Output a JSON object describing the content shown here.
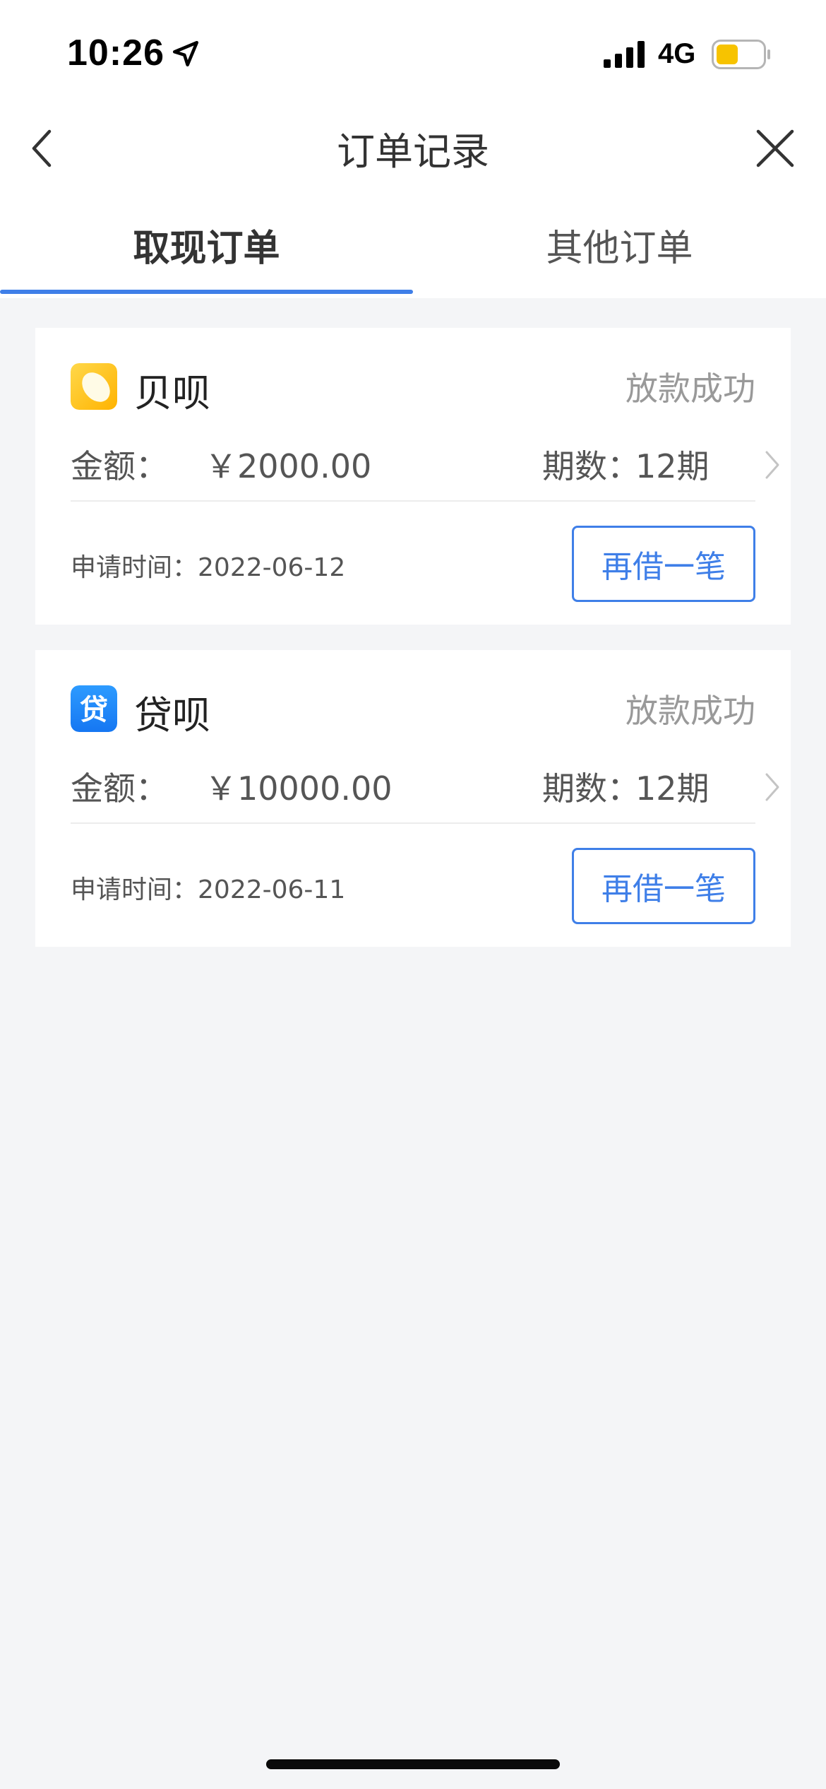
{
  "status_bar": {
    "time": "10:26",
    "network": "4G",
    "colors": {
      "battery_fill": "#f7c300"
    }
  },
  "nav": {
    "title": "订单记录"
  },
  "tabs": [
    {
      "label": "取现订单",
      "active": true
    },
    {
      "label": "其他订单",
      "active": false
    }
  ],
  "orders": [
    {
      "product": "贝呗",
      "logo": "rice-grain-logo",
      "status": "放款成功",
      "amount_label": "金额：",
      "amount": "￥2000.00",
      "period_label": "期数：",
      "period": "12期",
      "apply_label": "申请时间：",
      "apply_date": "2022-06-12",
      "button": "再借一笔"
    },
    {
      "product": "贷呗",
      "logo": "dai-character-logo",
      "logo_text": "贷",
      "status": "放款成功",
      "amount_label": "金额：",
      "amount": "￥10000.00",
      "period_label": "期数：",
      "period": "12期",
      "apply_label": "申请时间：",
      "apply_date": "2022-06-11",
      "button": "再借一笔"
    }
  ],
  "colors": {
    "accent": "#3f7fe8",
    "background": "#f4f5f7",
    "status_gray": "#999999"
  }
}
